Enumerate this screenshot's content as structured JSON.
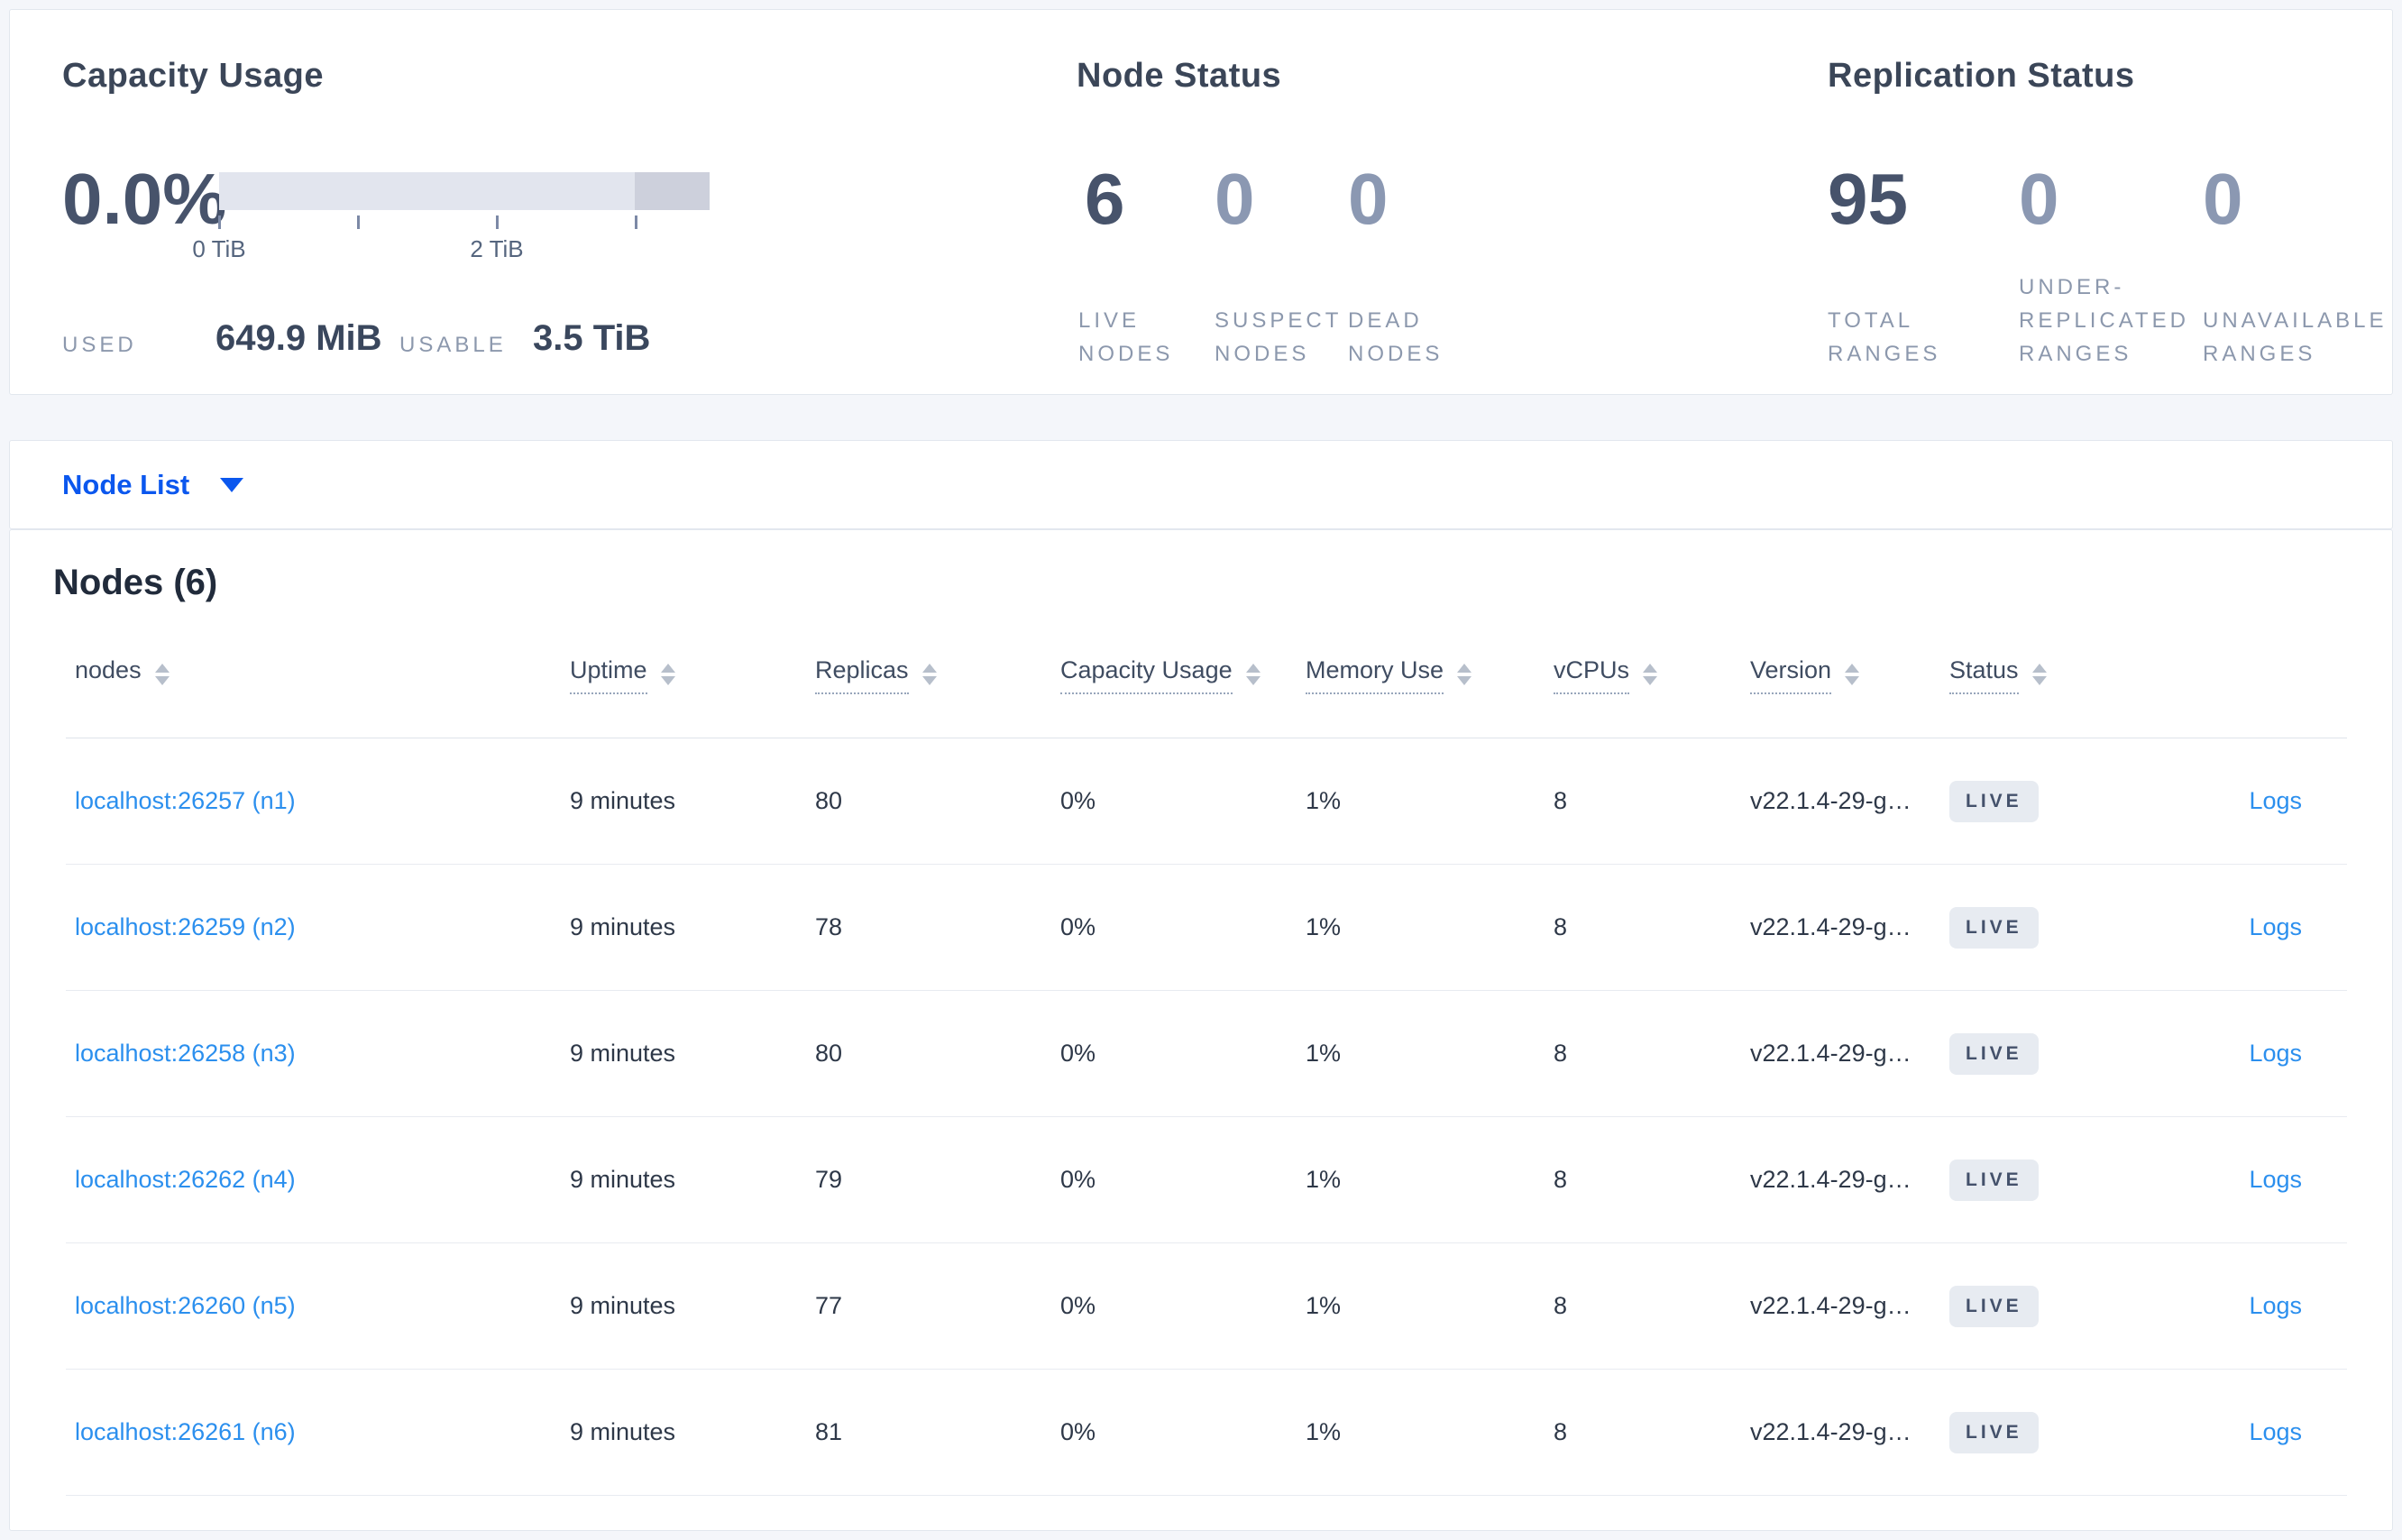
{
  "capacity_usage": {
    "title": "Capacity Usage",
    "percent": "0.0%",
    "tick_labels": [
      "0 TiB",
      "2 TiB"
    ],
    "used_label": "USED",
    "used_value": "649.9 MiB",
    "usable_label": "USABLE",
    "usable_value": "3.5 TiB"
  },
  "node_status": {
    "title": "Node Status",
    "metrics": [
      {
        "value": "6",
        "label": "LIVE NODES"
      },
      {
        "value": "0",
        "label": "SUSPECT NODES"
      },
      {
        "value": "0",
        "label": "DEAD NODES"
      }
    ]
  },
  "replication_status": {
    "title": "Replication Status",
    "metrics": [
      {
        "value": "95",
        "label": "TOTAL RANGES"
      },
      {
        "value": "0",
        "label": "UNDER-REPLICATED RANGES"
      },
      {
        "value": "0",
        "label": "UNAVAILABLE RANGES"
      }
    ]
  },
  "view_selector": {
    "label": "Node List"
  },
  "nodes_section": {
    "heading": "Nodes (6)",
    "columns": [
      "nodes",
      "Uptime",
      "Replicas",
      "Capacity Usage",
      "Memory Use",
      "vCPUs",
      "Version",
      "Status"
    ],
    "rows": [
      {
        "node": "localhost:26257 (n1)",
        "uptime": "9 minutes",
        "replicas": "80",
        "capacity_usage": "0%",
        "memory_use": "1%",
        "vcpus": "8",
        "version": "v22.1.4-29-g…",
        "status": "LIVE",
        "logs": "Logs"
      },
      {
        "node": "localhost:26259 (n2)",
        "uptime": "9 minutes",
        "replicas": "78",
        "capacity_usage": "0%",
        "memory_use": "1%",
        "vcpus": "8",
        "version": "v22.1.4-29-g…",
        "status": "LIVE",
        "logs": "Logs"
      },
      {
        "node": "localhost:26258 (n3)",
        "uptime": "9 minutes",
        "replicas": "80",
        "capacity_usage": "0%",
        "memory_use": "1%",
        "vcpus": "8",
        "version": "v22.1.4-29-g…",
        "status": "LIVE",
        "logs": "Logs"
      },
      {
        "node": "localhost:26262 (n4)",
        "uptime": "9 minutes",
        "replicas": "79",
        "capacity_usage": "0%",
        "memory_use": "1%",
        "vcpus": "8",
        "version": "v22.1.4-29-g…",
        "status": "LIVE",
        "logs": "Logs"
      },
      {
        "node": "localhost:26260 (n5)",
        "uptime": "9 minutes",
        "replicas": "77",
        "capacity_usage": "0%",
        "memory_use": "1%",
        "vcpus": "8",
        "version": "v22.1.4-29-g…",
        "status": "LIVE",
        "logs": "Logs"
      },
      {
        "node": "localhost:26261 (n6)",
        "uptime": "9 minutes",
        "replicas": "81",
        "capacity_usage": "0%",
        "memory_use": "1%",
        "vcpus": "8",
        "version": "v22.1.4-29-g…",
        "status": "LIVE",
        "logs": "Logs"
      }
    ]
  },
  "colors": {
    "page_bg": "#f4f6fa",
    "accent_blue": "#0b57ee",
    "link_blue": "#2b8fee",
    "bar_track": "#e2e5ee",
    "bar_segment": "#cdd0dc",
    "badge_bg": "#e7ebf1",
    "metric_primary": "#47536b",
    "metric_muted": "#8b98b2"
  }
}
